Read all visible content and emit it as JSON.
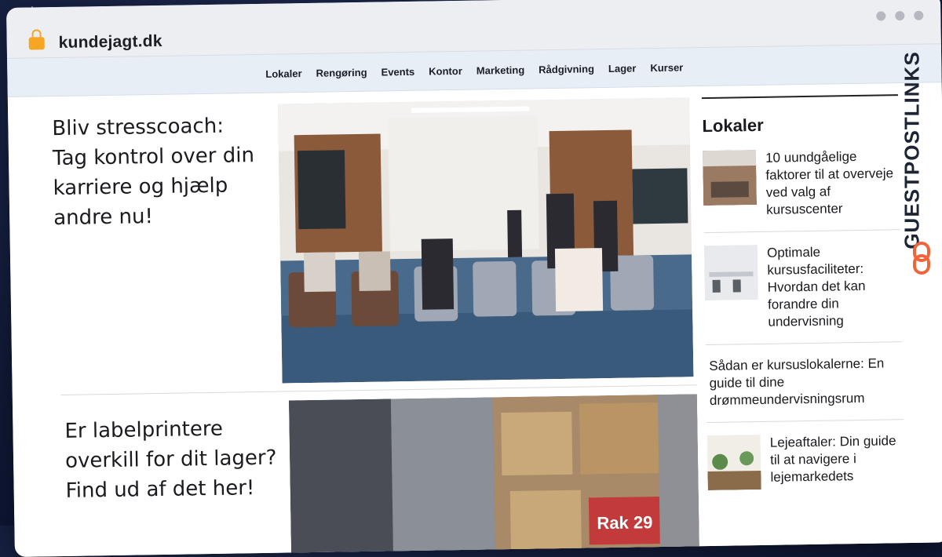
{
  "browser": {
    "url": "kundejagt.dk"
  },
  "nav": {
    "items": [
      "Lokaler",
      "Rengøring",
      "Events",
      "Kontor",
      "Marketing",
      "Rådgivning",
      "Lager",
      "Kurser"
    ]
  },
  "articles": [
    {
      "headline": "Bliv stresscoach: Tag kontrol over din karriere og hjælp andre nu!"
    },
    {
      "headline": "Er labelprintere overkill for dit lager? Find ud af det her!"
    }
  ],
  "sidebar": {
    "title": "Lokaler",
    "items": [
      {
        "title": "10 uundgåelige faktorer til at overveje ved valg af kursuscenter"
      },
      {
        "title": "Optimale kursusfaciliteter: Hvordan det kan forandre din undervisning"
      },
      {
        "title": "Sådan er kursuslokalerne: En guide til dine drømmeundervisningsrum"
      },
      {
        "title": "Lejeaftaler: Din guide til at navigere i lejemarkedets"
      }
    ]
  },
  "warehouse_label": "Rak 29",
  "watermark": "GUESTPOSTLINKS"
}
